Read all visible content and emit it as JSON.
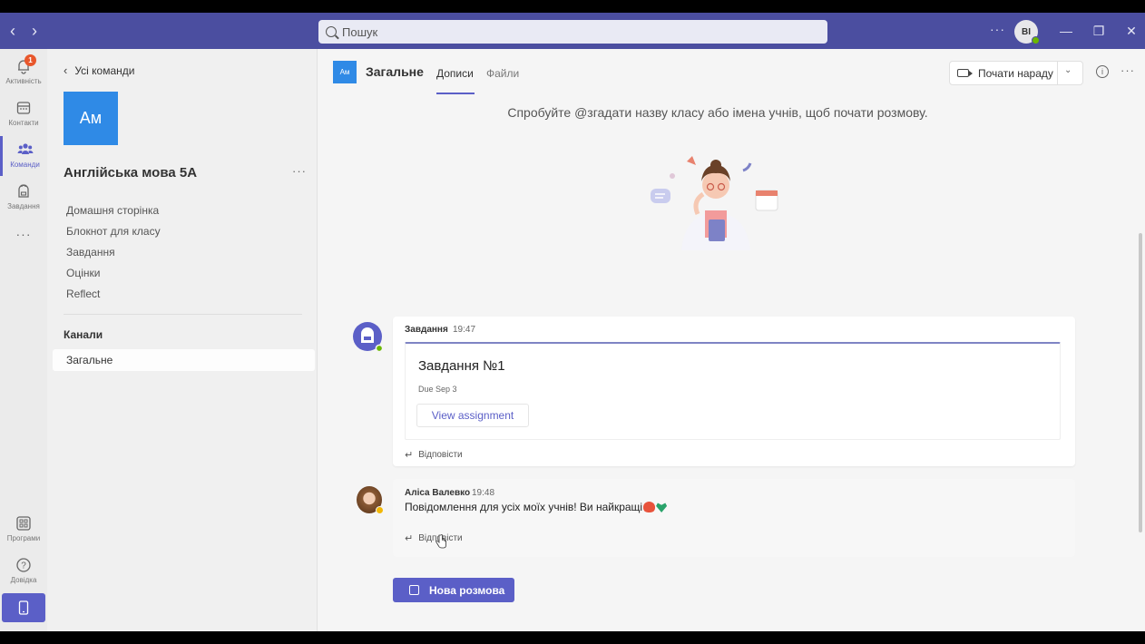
{
  "titlebar": {
    "back_label": "‹",
    "forward_label": "›",
    "search_placeholder": "Пошук",
    "more_label": "···",
    "user_initials": "BI",
    "minimize_label": "—",
    "restore_label": "❐",
    "close_label": "✕"
  },
  "rail": {
    "items": [
      {
        "label": "Активність",
        "icon": "bell-icon",
        "badge": "1"
      },
      {
        "label": "Контакти",
        "icon": "calendar-icon"
      },
      {
        "label": "Команди",
        "icon": "teams-icon"
      },
      {
        "label": "Завдання",
        "icon": "backpack-icon"
      }
    ],
    "more_label": "···",
    "apps_label": "Програми",
    "help_label": "Довідка"
  },
  "team": {
    "back_label": "Усі команди",
    "tile_initials": "Ам",
    "name": "Англійська мова 5А",
    "more_label": "···",
    "links": [
      "Домашня сторінка",
      "Блокнот для класу",
      "Завдання",
      "Оцінки",
      "Reflect"
    ],
    "channels_header": "Канали",
    "channel_selected": "Загальне"
  },
  "channel": {
    "tile_initials": "Ам",
    "title": "Загальне",
    "tabs": [
      "Дописи",
      "Файли"
    ],
    "meet_button": "Почати нараду",
    "more_label": "···",
    "info_label": "i",
    "hint": "Спробуйте @згадати назву класу або імена учнів, щоб почати розмову."
  },
  "messages": [
    {
      "author": "Завдання",
      "time": "19:47",
      "card_title": "Завдання №1",
      "card_due": "Due Sep 3",
      "card_button": "View assignment",
      "reply_label": "Відповісти"
    },
    {
      "author": "Аліса Валевко",
      "time": "19:48",
      "text": "Повідомлення для усіх моїх учнів! Ви найкращі",
      "reply_label": "Відповісти"
    }
  ],
  "compose": {
    "new_conversation_label": "Нова розмова"
  },
  "colors": {
    "titlebar": "#4b4ea0",
    "accent": "#5b5fc7",
    "team_tile": "#2f8ae6"
  }
}
